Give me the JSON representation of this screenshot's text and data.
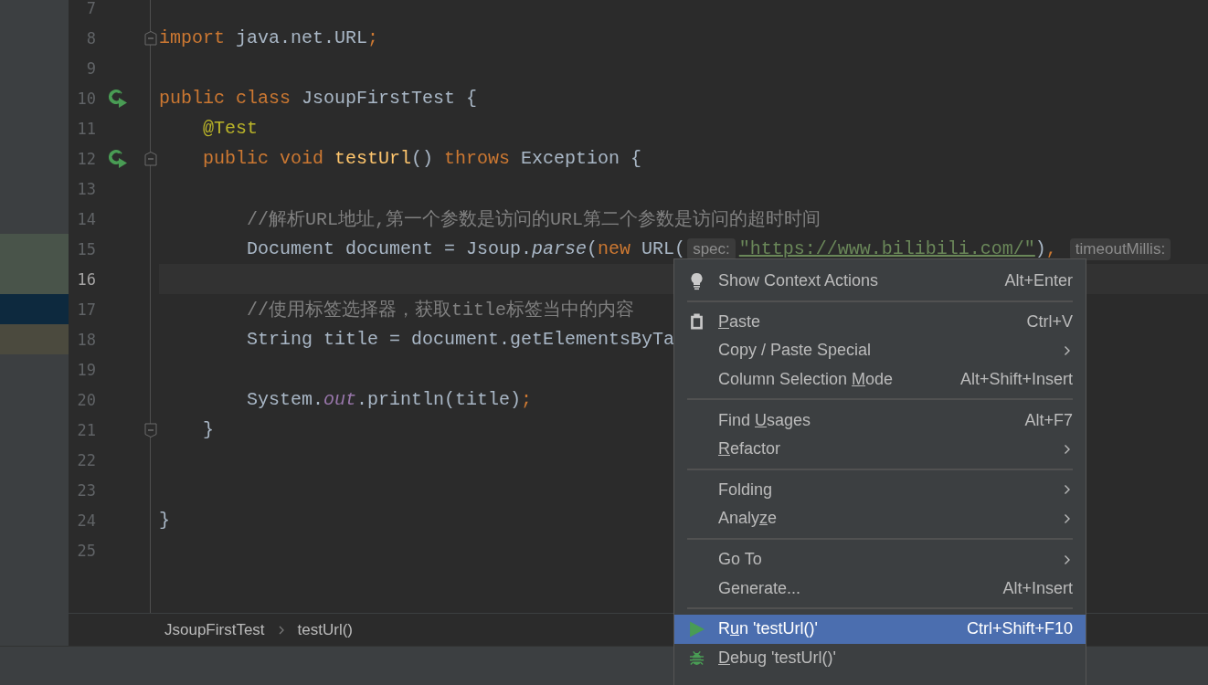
{
  "editor": {
    "lines": [
      {
        "number": "7",
        "current": false
      },
      {
        "number": "8",
        "current": false,
        "fold_start": true,
        "tokens": [
          {
            "t": "import ",
            "kind": "keyword"
          },
          {
            "t": "java.net.URL",
            "kind": "plain"
          },
          {
            "t": ";",
            "kind": "keyword"
          }
        ]
      },
      {
        "number": "9",
        "current": false
      },
      {
        "number": "10",
        "current": false,
        "run_button": true,
        "tokens": [
          {
            "t": "public class ",
            "kind": "keyword"
          },
          {
            "t": "JsoupFirstTest {",
            "kind": "plain"
          }
        ],
        "children": [
          {
            "number": "11",
            "current": false,
            "tokens": [
              {
                "t": "@Test",
                "kind": "annotation"
              }
            ]
          },
          {
            "number": "12",
            "current": false,
            "run_button": true,
            "fold_start": true,
            "tokens": [
              {
                "t": "public void ",
                "kind": "keyword"
              },
              {
                "t": "testUrl",
                "kind": "method"
              },
              {
                "t": "() ",
                "kind": "plain"
              },
              {
                "t": "throws ",
                "kind": "keyword"
              },
              {
                "t": "Exception {",
                "kind": "plain"
              }
            ],
            "children": [
              {
                "number": "13",
                "current": false
              },
              {
                "number": "14",
                "current": false,
                "tokens": [
                  {
                    "t": "//解析URL地址,第一个参数是访问的URL第二个参数是访问的超时时间",
                    "kind": "comment"
                  }
                ]
              },
              {
                "number": "15",
                "current": false,
                "color": "#49544a",
                "tokens": [
                  {
                    "t": "Document document = Jsoup.",
                    "kind": "plain"
                  },
                  {
                    "t": "parse",
                    "kind": "static"
                  },
                  {
                    "t": "(",
                    "kind": "plain"
                  },
                  {
                    "t": "new ",
                    "kind": "keyword"
                  },
                  {
                    "t": "URL(",
                    "kind": "plain"
                  },
                  {
                    "t": "spec:",
                    "kind": "hint"
                  },
                  {
                    "t": "\"https://www.bilibili.com/\"",
                    "kind": "string"
                  },
                  {
                    "t": ")",
                    "kind": "plain"
                  },
                  {
                    "t": ", ",
                    "kind": "keyword"
                  },
                  {
                    "t": "timeoutMillis:",
                    "kind": "hint"
                  }
                ]
              },
              {
                "number": "16",
                "current": true,
                "color": "#49544a"
              },
              {
                "number": "17",
                "current": false,
                "color": "#0d293e",
                "tokens": [
                  {
                    "t": "//使用标签选择器，获取title标签当中的内容",
                    "kind": "comment"
                  }
                ]
              },
              {
                "number": "18",
                "current": false,
                "color": "#4b4a3e",
                "tokens": [
                  {
                    "t": "String title = document.getElementsByTa",
                    "kind": "plain"
                  }
                ]
              },
              {
                "number": "19",
                "current": false
              },
              {
                "number": "20",
                "current": false,
                "tokens": [
                  {
                    "t": "System.",
                    "kind": "plain"
                  },
                  {
                    "t": "out",
                    "kind": "field"
                  },
                  {
                    "t": ".println(title)",
                    "kind": "plain"
                  },
                  {
                    "t": ";",
                    "kind": "keyword"
                  }
                ]
              }
            ]
          },
          {
            "number": "21",
            "current": false,
            "fold_end": true,
            "tokens": [
              {
                "t": "}",
                "kind": "plain"
              }
            ]
          },
          {
            "number": "22",
            "current": false
          },
          {
            "number": "23",
            "current": false
          }
        ]
      },
      {
        "number": "24",
        "current": false,
        "tokens": [
          {
            "t": "}",
            "kind": "plain"
          }
        ]
      },
      {
        "number": "25",
        "current": false
      }
    ]
  },
  "breadcrumb": [
    "JsoupFirstTest",
    "testUrl()"
  ],
  "context_menu": [
    {
      "kind": "bulb",
      "label": {
        "post": "Show Context Actions"
      },
      "shortcut": "Alt+Enter",
      "submenu": false,
      "selected": false
    },
    {
      "kind": "separator"
    },
    {
      "kind": "clipboard",
      "label": {
        "key": "P",
        "post": "aste"
      },
      "shortcut": "Ctrl+V",
      "submenu": false,
      "selected": false
    },
    {
      "kind": "plain",
      "label": {
        "post": "Copy / Paste Special"
      },
      "submenu": true,
      "selected": false
    },
    {
      "kind": "plain",
      "label": {
        "pre": "Column Selection ",
        "key": "M",
        "post": "ode"
      },
      "shortcut": "Alt+Shift+Insert",
      "submenu": false,
      "selected": false
    },
    {
      "kind": "separator"
    },
    {
      "kind": "plain",
      "label": {
        "pre": "Find ",
        "key": "U",
        "post": "sages"
      },
      "shortcut": "Alt+F7",
      "submenu": false,
      "selected": false
    },
    {
      "kind": "plain",
      "label": {
        "key": "R",
        "post": "efactor"
      },
      "submenu": true,
      "selected": false
    },
    {
      "kind": "separator"
    },
    {
      "kind": "plain",
      "label": {
        "post": "Folding"
      },
      "submenu": true,
      "selected": false
    },
    {
      "kind": "plain",
      "label": {
        "pre": "Analy",
        "key": "z",
        "post": "e"
      },
      "submenu": true,
      "selected": false
    },
    {
      "kind": "separator"
    },
    {
      "kind": "plain",
      "label": {
        "post": "Go To"
      },
      "submenu": true,
      "selected": false
    },
    {
      "kind": "plain",
      "label": {
        "post": "Generate..."
      },
      "shortcut": "Alt+Insert",
      "submenu": false,
      "selected": false
    },
    {
      "kind": "separator"
    },
    {
      "kind": "run",
      "label": {
        "pre": "R",
        "key": "u",
        "post": "n 'testUrl()'"
      },
      "shortcut": "Ctrl+Shift+F10",
      "submenu": false,
      "selected": true
    },
    {
      "kind": "bug",
      "label": {
        "key": "D",
        "post": "ebug 'testUrl()'"
      },
      "submenu": false,
      "selected": false
    }
  ]
}
